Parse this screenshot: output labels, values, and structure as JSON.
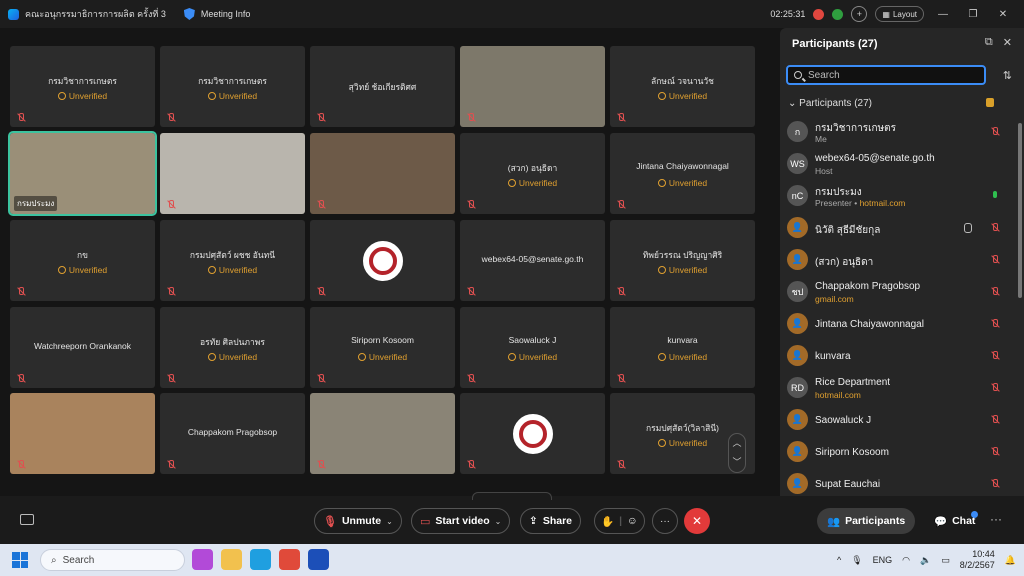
{
  "window": {
    "title": "คณะอนุกรรมาธิการการผลิต ครั้งที่ 3",
    "meeting_info": "Meeting Info",
    "timer": "02:25:31",
    "layout_label": "Layout"
  },
  "grid": {
    "tiles": [
      {
        "name": "กรมวิชาการเกษตร",
        "status": "Unverified",
        "kind": "name"
      },
      {
        "name": "กรมวิชาการเกษตร",
        "status": "Unverified",
        "kind": "name"
      },
      {
        "name": "สุวิทย์ ช้อเกียรติศศ",
        "status": "",
        "kind": "name"
      },
      {
        "name": "",
        "status": "",
        "kind": "video"
      },
      {
        "name": "ลักษณ์ วจนานวัช",
        "status": "Unverified",
        "kind": "name"
      },
      {
        "name": "กรมประมง",
        "status": "",
        "kind": "video-active"
      },
      {
        "name": "",
        "status": "",
        "kind": "video"
      },
      {
        "name": "",
        "status": "",
        "kind": "video"
      },
      {
        "name": "(สวก) อนุธิดา",
        "status": "Unverified",
        "kind": "name"
      },
      {
        "name": "Jintana Chaiyawonnagal",
        "status": "Unverified",
        "kind": "name"
      },
      {
        "name": "กข",
        "status": "Unverified",
        "kind": "name"
      },
      {
        "name": "กรมปศุสัตว์ ผชช อันทนี",
        "status": "Unverified",
        "kind": "name"
      },
      {
        "name": "",
        "status": "",
        "kind": "seal"
      },
      {
        "name": "webex64-05@senate.go.th",
        "status": "",
        "kind": "name"
      },
      {
        "name": "ทิพย์วรรณ ปริญญาศิริ",
        "status": "Unverified",
        "kind": "name"
      },
      {
        "name": "Watchreeporn Orankanok",
        "status": "",
        "kind": "name"
      },
      {
        "name": "อรทัย ศิลปนภาพร",
        "status": "Unverified",
        "kind": "name"
      },
      {
        "name": "Siriporn Kosoom",
        "status": "Unverified",
        "kind": "name"
      },
      {
        "name": "Saowaluck J",
        "status": "Unverified",
        "kind": "name"
      },
      {
        "name": "kunvara",
        "status": "Unverified",
        "kind": "name"
      },
      {
        "name": "",
        "status": "",
        "kind": "video"
      },
      {
        "name": "Chappakom Pragobsop",
        "status": "",
        "kind": "name"
      },
      {
        "name": "",
        "status": "",
        "kind": "video"
      },
      {
        "name": "",
        "status": "",
        "kind": "seal"
      },
      {
        "name": "กรมปศุสัตว์(วิลาสินี)",
        "status": "Unverified",
        "kind": "name"
      }
    ]
  },
  "panel": {
    "title": "Participants (27)",
    "search_placeholder": "Search",
    "group_label": "Participants (27)",
    "participants": [
      {
        "initials": "ก",
        "name": "กรมวิชาการเกษตร",
        "role": "Me",
        "mail": "",
        "mic": "off",
        "avatar": "grey"
      },
      {
        "initials": "WS",
        "name": "webex64-05@senate.go.th",
        "role": "Host",
        "mail": "",
        "mic": "none",
        "avatar": "grey"
      },
      {
        "initials": "nC",
        "name": "กรมประมง",
        "role": "Presenter",
        "mail": "hotmail.com",
        "mic": "on",
        "avatar": "grey"
      },
      {
        "initials": "👤",
        "name": "นิวัติ สุธีมีชัยกุล",
        "role": "",
        "mail": "",
        "mic": "off",
        "avatar": "gold",
        "hand": true
      },
      {
        "initials": "👤",
        "name": "(สวก) อนุธิดา",
        "role": "",
        "mail": "",
        "mic": "off",
        "avatar": "gold"
      },
      {
        "initials": "ชป",
        "name": "Chappakom Pragobsop",
        "role": "",
        "mail": "gmail.com",
        "mic": "off",
        "avatar": "grey"
      },
      {
        "initials": "👤",
        "name": "Jintana Chaiyawonnagal",
        "role": "",
        "mail": "",
        "mic": "off",
        "avatar": "gold"
      },
      {
        "initials": "👤",
        "name": "kunvara",
        "role": "",
        "mail": "",
        "mic": "off",
        "avatar": "gold"
      },
      {
        "initials": "RD",
        "name": "Rice Department",
        "role": "",
        "mail": "hotmail.com",
        "mic": "off",
        "avatar": "grey"
      },
      {
        "initials": "👤",
        "name": "Saowaluck J",
        "role": "",
        "mail": "",
        "mic": "off",
        "avatar": "gold"
      },
      {
        "initials": "👤",
        "name": "Siriporn Kosoom",
        "role": "",
        "mail": "",
        "mic": "off",
        "avatar": "gold"
      },
      {
        "initials": "👤",
        "name": "Supat Eauchai",
        "role": "",
        "mail": "",
        "mic": "off",
        "avatar": "gold"
      }
    ]
  },
  "controls": {
    "unmute": "Unmute",
    "start_video": "Start video",
    "share": "Share",
    "participants": "Participants",
    "chat": "Chat"
  },
  "taskbar": {
    "search": "Search",
    "lang": "ENG",
    "time": "10:44",
    "date": "8/2/2567"
  }
}
